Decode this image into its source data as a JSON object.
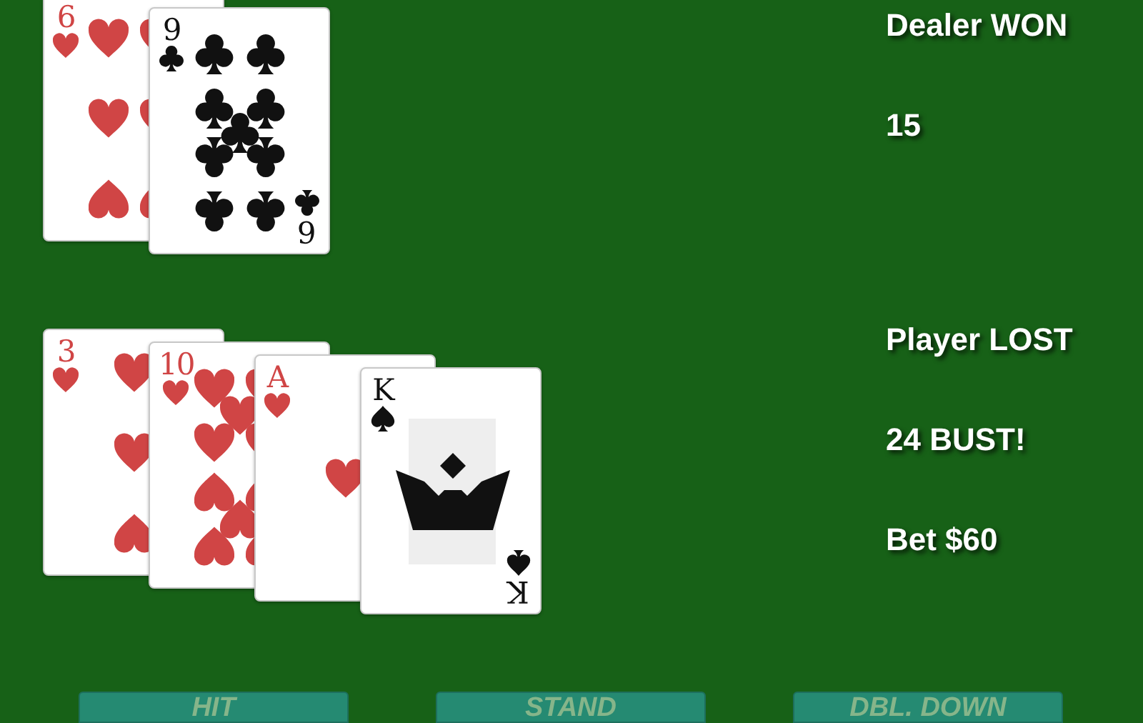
{
  "dealer": {
    "status": "Dealer WON",
    "score": "15",
    "cards": [
      {
        "rank": "6",
        "kind": "hearts"
      },
      {
        "rank": "9",
        "kind": "clubs",
        "bottom_rank": "6"
      }
    ]
  },
  "player": {
    "status": "Player LOST",
    "score": "24 BUST!",
    "bet": "Bet $60",
    "cards": [
      {
        "rank": "3",
        "kind": "hearts"
      },
      {
        "rank": "10",
        "kind": "hearts"
      },
      {
        "rank": "A",
        "kind": "hearts"
      },
      {
        "rank": "K",
        "kind": "spades",
        "bottom_rank": "K"
      }
    ]
  },
  "buttons": [
    {
      "label": "HIT"
    },
    {
      "label": "STAND"
    },
    {
      "label": "DBL. DOWN"
    }
  ]
}
